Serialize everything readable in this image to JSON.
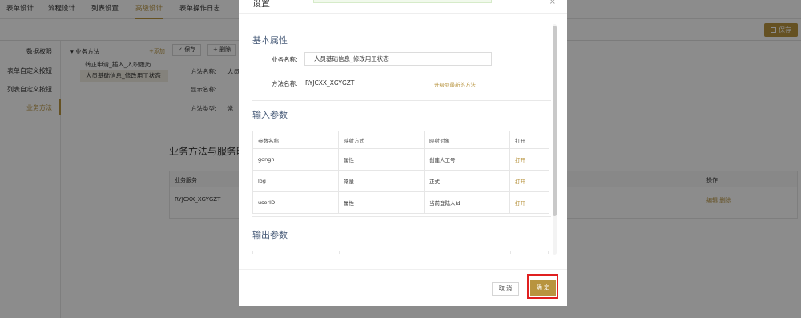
{
  "topnav": {
    "tabs": [
      "表单设计",
      "流程设计",
      "列表设置",
      "高级设计",
      "表单操作日志"
    ],
    "active_index": 3
  },
  "toolbar": {
    "save_label": "保存"
  },
  "leftnav": {
    "items": [
      "数据权限",
      "表单自定义按钮",
      "列表自定义按钮",
      "业务方法"
    ],
    "active_index": 3
  },
  "tree": {
    "root_label": "业务方法",
    "add_label": "+添加",
    "items": [
      "转正申请_插入_入职履历",
      "人员基础信息_修改用工状态"
    ]
  },
  "detail": {
    "save_label": "保存",
    "delete_label": "删除",
    "method_name_label": "方法名称:",
    "method_name_value": "人员",
    "display_name_label": "显示名称:",
    "method_type_label": "方法类型:",
    "method_type_value": "常"
  },
  "service_section": {
    "title": "业务方法与服务映",
    "columns": [
      "业务服务",
      "操作"
    ],
    "row": {
      "service": "RYJCXX_XGYGZT",
      "edit": "编辑",
      "delete": "删除"
    }
  },
  "modal": {
    "title": "设置",
    "close_symbol": "×",
    "basic_section_title": "基本属性",
    "business_name_label": "业务名称:",
    "business_name_value": "人员基础信息_修改用工状态",
    "method_name_label": "方法名称:",
    "method_name_value": "RYJCXX_XGYGZT",
    "upgrade_link": "升级到最新的方法",
    "input_section_title": "输入参数",
    "input_columns": [
      "参数名称",
      "映射方式",
      "映射对象",
      "打开"
    ],
    "input_rows": [
      {
        "name": "gongh",
        "mode": "属性",
        "target": "创建人工号",
        "open": "打开"
      },
      {
        "name": "log",
        "mode": "常量",
        "target": "正式",
        "open": "打开"
      },
      {
        "name": "userID",
        "mode": "属性",
        "target": "当前登陆人Id",
        "open": "打开"
      }
    ],
    "output_section_title": "输出参数",
    "cancel_label": "取 消",
    "ok_label": "确 定"
  },
  "colors": {
    "accent": "#b8943f",
    "section_title": "#445876",
    "highlight": "#e02020"
  }
}
